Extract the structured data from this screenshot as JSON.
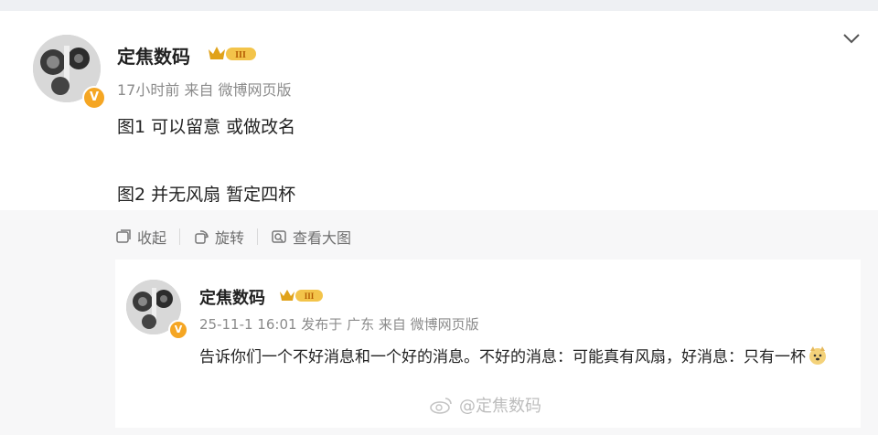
{
  "post": {
    "author": "定焦数码",
    "level_badge": "III",
    "meta": "17小时前  来自 微博网页版",
    "line1": "图1 可以留意 或做改名",
    "line2": "图2 并无风扇 暂定四杯",
    "verified_mark": "V"
  },
  "actions": {
    "collapse": "收起",
    "rotate": "旋转",
    "view_large": "查看大图"
  },
  "quoted": {
    "author": "定焦数码",
    "level_badge": "III",
    "meta": "25-11-1 16:01 发布于 广东  来自 微博网页版",
    "text": "告诉你们一个不好消息和一个好的消息。不好的消息：可能真有风扇，好消息：只有一杯",
    "emoji": "doge-emoji"
  },
  "watermark": "@定焦数码",
  "colors": {
    "background": "#eef0f3",
    "card": "#ffffff",
    "muted_text": "#8b8b8b",
    "verified_badge": "#f5a623"
  }
}
